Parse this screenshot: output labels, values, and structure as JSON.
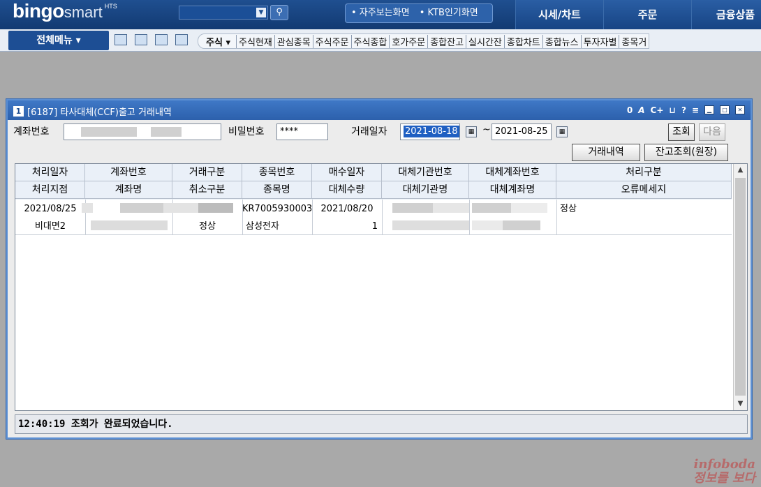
{
  "top": {
    "logo_brand": "bingo",
    "logo_product": "smart",
    "logo_tag": "HTS",
    "quick_links": [
      "• 자주보는화면",
      "• KTB인기화면"
    ],
    "nav": [
      "시세/차트",
      "주문",
      "금융상품"
    ]
  },
  "menubar": {
    "all_menu": "전체메뉴 ▾",
    "category": "주식 ▾",
    "items": [
      "주식현재",
      "관심종목",
      "주식주문",
      "주식종합",
      "호가주문",
      "종합잔고",
      "실시간잔",
      "종합차트",
      "종합뉴스",
      "투자자별",
      "종목거"
    ]
  },
  "window": {
    "num": "1",
    "title": "[6187] 타사대체(CCF)출고 거래내역",
    "tool_icons": [
      "0",
      "A",
      "C+",
      "⊔",
      "?",
      "≡"
    ]
  },
  "form": {
    "account_label": "계좌번호",
    "password_label": "비밀번호",
    "password_value": "****",
    "date_label": "거래일자",
    "date_from": "2021-08-18",
    "date_sep": "~",
    "date_to": "2021-08-25",
    "query_button": "조회",
    "next_button": "다음",
    "history_button": "거래내역",
    "balance_button": "잔고조회(원장)"
  },
  "grid": {
    "header_row1": [
      "처리일자",
      "계좌번호",
      "거래구분",
      "종목번호",
      "매수일자",
      "대체기관번호",
      "대체계좌번호",
      "처리구분"
    ],
    "header_row2": [
      "처리지점",
      "계좌명",
      "취소구분",
      "종목명",
      "대체수량",
      "대체기관명",
      "대체계좌명",
      "오류메세지"
    ],
    "rows": [
      {
        "line1": [
          "2021/08/25",
          "",
          "",
          "KR7005930003",
          "2021/08/20",
          "",
          "",
          "정상"
        ],
        "line2": [
          "비대면2",
          "",
          "정상",
          "삼성전자",
          "1",
          "",
          "",
          ""
        ]
      }
    ]
  },
  "status": {
    "message": "12:40:19 조회가 완료되었습니다."
  },
  "watermark": {
    "line1": "infoboda",
    "line2": "정보를 보다"
  }
}
